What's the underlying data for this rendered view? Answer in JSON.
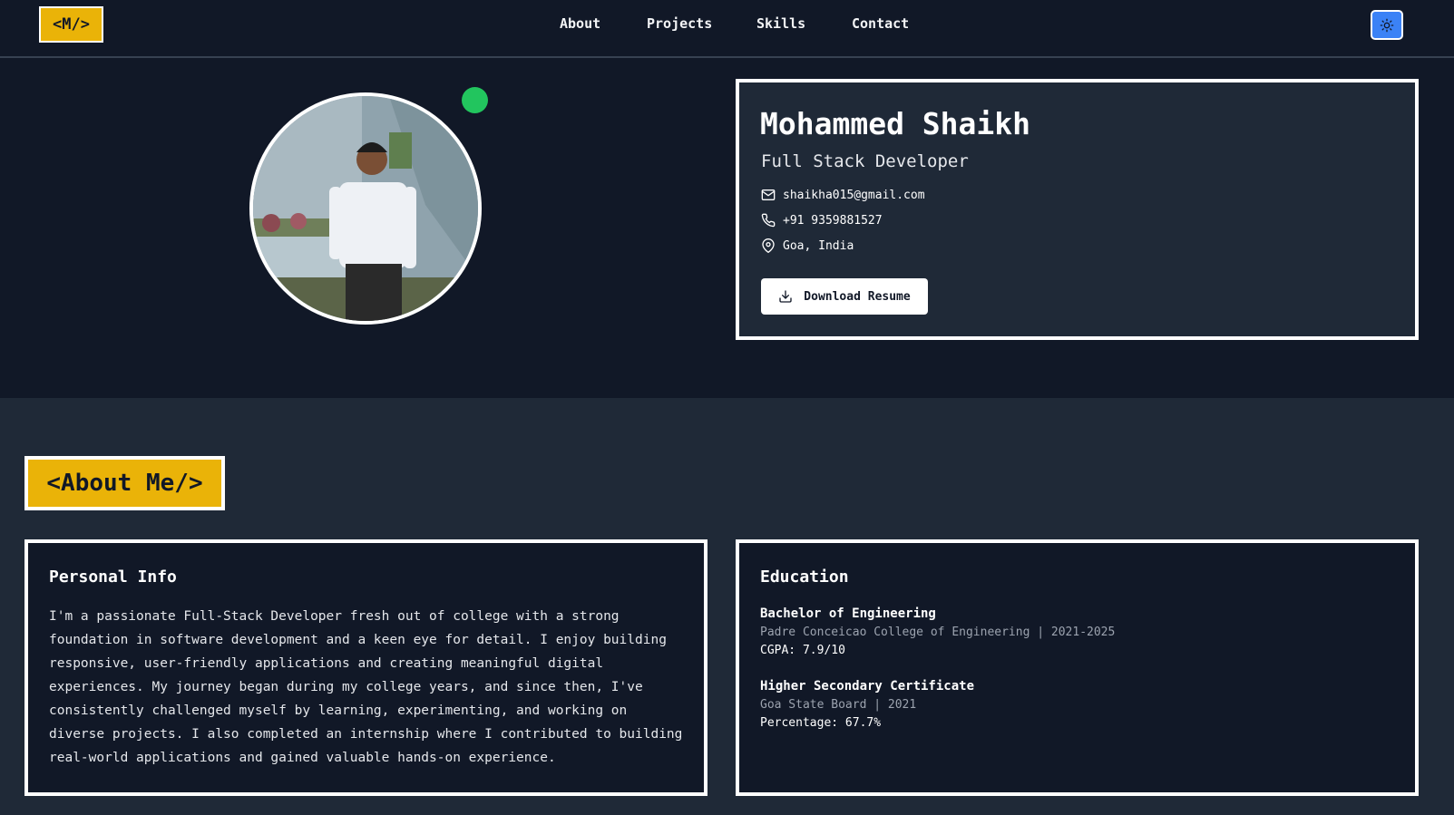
{
  "nav": {
    "logo": "<M/>",
    "links": [
      "About",
      "Projects",
      "Skills",
      "Contact"
    ]
  },
  "hero": {
    "name": "Mohammed Shaikh",
    "role": "Full Stack Developer",
    "email": "shaikha015@gmail.com",
    "phone": "+91 9359881527",
    "location": "Goa, India",
    "download_label": "Download Resume",
    "status": "online"
  },
  "about": {
    "title": "<About Me/>",
    "personal": {
      "title": "Personal Info",
      "text": "I'm a passionate Full-Stack Developer fresh out of college with a strong foundation in software development and a keen eye for detail. I enjoy building responsive, user-friendly applications and creating meaningful digital experiences. My journey began during my college years, and since then, I've consistently challenged myself by learning, experimenting, and working on diverse projects. I also completed an internship where I contributed to building real-world applications and gained valuable hands-on experience."
    },
    "education": {
      "title": "Education",
      "items": [
        {
          "degree": "Bachelor of Engineering",
          "meta": "Padre Conceicao College of Engineering | 2021-2025",
          "score": "CGPA: 7.9/10"
        },
        {
          "degree": "Higher Secondary Certificate",
          "meta": "Goa State Board | 2021",
          "score": "Percentage: 67.7%"
        }
      ]
    }
  },
  "colors": {
    "accent": "#eab308",
    "background": "#111827",
    "surface": "#1f2937",
    "status": "#22c55e",
    "toggle": "#3b82f6"
  },
  "icons": {
    "theme": "sun-icon",
    "email": "mail-icon",
    "phone": "phone-icon",
    "location": "map-pin-icon",
    "download": "download-icon"
  }
}
